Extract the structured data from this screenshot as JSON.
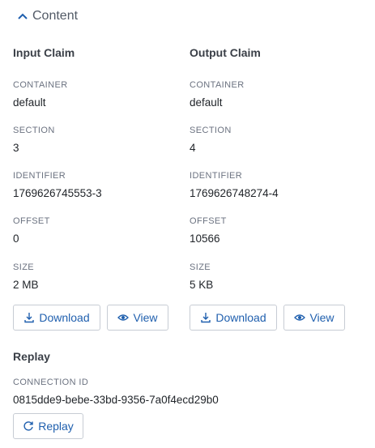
{
  "section": {
    "title": "Content",
    "expanded": true
  },
  "input_claim": {
    "title": "Input Claim",
    "fields": [
      {
        "label": "CONTAINER",
        "value": "default"
      },
      {
        "label": "SECTION",
        "value": "3"
      },
      {
        "label": "IDENTIFIER",
        "value": "1769626745553-3"
      },
      {
        "label": "OFFSET",
        "value": "0"
      },
      {
        "label": "SIZE",
        "value": "2 MB"
      }
    ],
    "download_label": "Download",
    "view_label": "View"
  },
  "output_claim": {
    "title": "Output Claim",
    "fields": [
      {
        "label": "CONTAINER",
        "value": "default"
      },
      {
        "label": "SECTION",
        "value": "4"
      },
      {
        "label": "IDENTIFIER",
        "value": "1769626748274-4"
      },
      {
        "label": "OFFSET",
        "value": "10566"
      },
      {
        "label": "SIZE",
        "value": "5 KB"
      }
    ],
    "download_label": "Download",
    "view_label": "View"
  },
  "replay": {
    "title": "Replay",
    "connection_label": "CONNECTION ID",
    "connection_value": "0815dde9-bebe-33bd-9356-7a0f4ecd29b0",
    "button_label": "Replay"
  },
  "colors": {
    "accent": "#1f5fae",
    "border": "#c7ccd4",
    "label": "#6b7280"
  }
}
